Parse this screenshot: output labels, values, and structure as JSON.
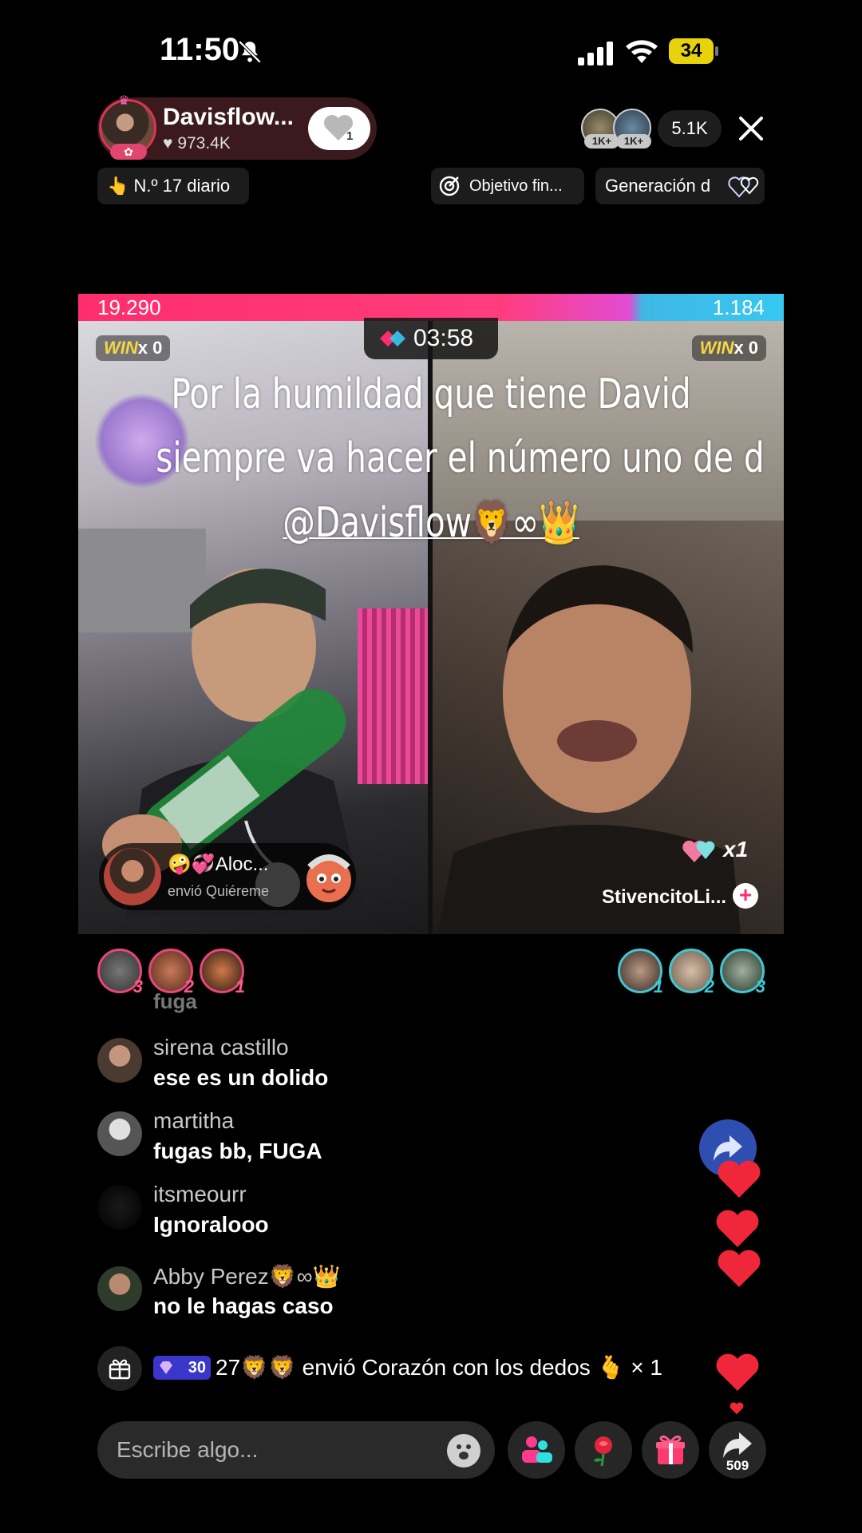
{
  "status_bar": {
    "time": "11:50",
    "battery": "34",
    "icons": [
      "bell-off-icon",
      "signal-icon",
      "wifi-icon",
      "battery-icon"
    ]
  },
  "host": {
    "name": "Davisflow...",
    "likes": "973.4K",
    "follow_count": "1"
  },
  "viewers": {
    "badges": [
      "1K+",
      "1K+"
    ],
    "count": "5.1K"
  },
  "chips": {
    "daily_rank": "N.º 17 diario",
    "goal": "Objetivo fin...",
    "generation": "Generación d"
  },
  "battle": {
    "score_left": "19.290",
    "score_right": "1.184",
    "win_left": {
      "word": "WIN",
      "count": "x 0"
    },
    "win_right": {
      "word": "WIN",
      "count": "x 0"
    },
    "timer": "03:58",
    "overlay_lines": [
      "Por la humildad que tiene David",
      "siempre va hacer el número uno de d",
      "@Davisflow🦁∞👑"
    ],
    "gift_sender": "🤪💞Aloc...",
    "gift_action": "envió Quiéreme",
    "opp_hearts": "x1",
    "opp_name": "StivencitoLi...",
    "opp_follow": "+"
  },
  "supporters": {
    "left_ranks": [
      "3",
      "2",
      "1"
    ],
    "right_ranks": [
      "1",
      "2",
      "3"
    ]
  },
  "chat": {
    "faded": "fuga",
    "messages": [
      {
        "user": "sirena castillo",
        "text": "ese es un dolido"
      },
      {
        "user": "martitha",
        "text": "fugas bb, FUGA"
      },
      {
        "user": "itsmeourr",
        "text": "Ignoralooo"
      },
      {
        "user": "Abby Perez🦁∞👑",
        "text": "no le hagas caso"
      }
    ]
  },
  "gift_notice": {
    "level": "30",
    "text": "27🦁🦁 envió Corazón con los dedos 🫰 × 1"
  },
  "bottom_bar": {
    "placeholder": "Escribe algo...",
    "share_count": "509"
  },
  "colors": {
    "pink": "#ff2d6e",
    "cyan": "#36c8f0",
    "win_gold": "#f5d742",
    "heart_red": "#f0263a"
  }
}
